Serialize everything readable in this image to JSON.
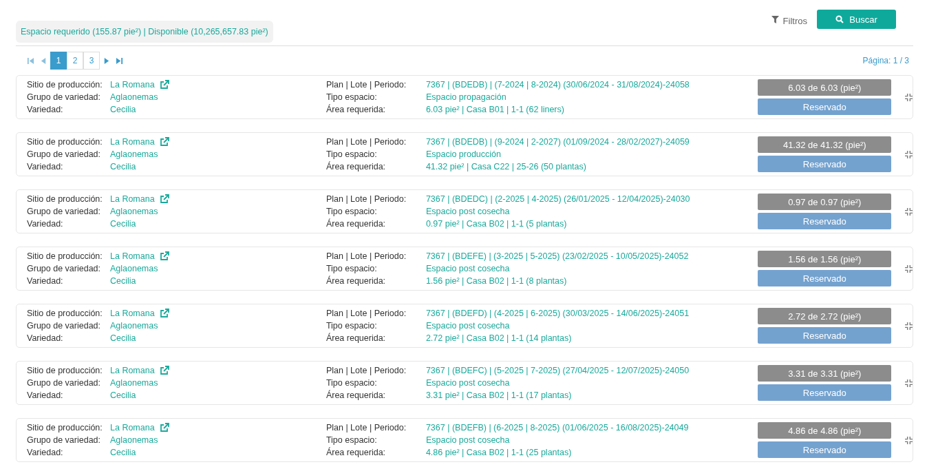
{
  "summary": "Espacio requerido (155.87 pie²) | Disponible (10,265,657.83 pie²)",
  "filters_label": "Filtros",
  "search_button": "Buscar",
  "pagination": {
    "pages": [
      {
        "label": "1",
        "selected": true
      },
      {
        "label": "2",
        "selected": false
      },
      {
        "label": "3",
        "selected": false
      }
    ],
    "page_info": "Página: 1 / 3"
  },
  "cards": [
    {
      "site_label": "Sitio de producción:",
      "site": "La Romana",
      "group_label": "Grupo de variedad:",
      "group": "Aglaonemas",
      "variety_label": "Variedad:",
      "variety": "Cecilia",
      "plan_label": "Plan | Lote | Periodo:",
      "plan": "7367 | (BDEDB) | (7-2024 | 8-2024) (30/06/2024 - 31/08/2024)-24058",
      "type_label": "Tipo espacio:",
      "type": "Espacio propagación",
      "area_label": "Área requerida:",
      "area": "6.03 pie² | Casa B01 | 1-1 (62 liners)",
      "amount": "6.03 de 6.03 (pie²)",
      "status": "Reservado"
    },
    {
      "site_label": "Sitio de producción:",
      "site": "La Romana",
      "group_label": "Grupo de variedad:",
      "group": "Aglaonemas",
      "variety_label": "Variedad:",
      "variety": "Cecilia",
      "plan_label": "Plan | Lote | Periodo:",
      "plan": "7367 | (BDEDB) | (9-2024 | 2-2027) (01/09/2024 - 28/02/2027)-24059",
      "type_label": "Tipo espacio:",
      "type": "Espacio producción",
      "area_label": "Área requerida:",
      "area": "41.32 pie² | Casa C22 | 25-26 (50 plantas)",
      "amount": "41.32 de 41.32 (pie²)",
      "status": "Reservado"
    },
    {
      "site_label": "Sitio de producción:",
      "site": "La Romana",
      "group_label": "Grupo de variedad:",
      "group": "Aglaonemas",
      "variety_label": "Variedad:",
      "variety": "Cecilia",
      "plan_label": "Plan | Lote | Periodo:",
      "plan": "7367 | (BDEDC) | (2-2025 | 4-2025) (26/01/2025 - 12/04/2025)-24030",
      "type_label": "Tipo espacio:",
      "type": "Espacio post cosecha",
      "area_label": "Área requerida:",
      "area": "0.97 pie² | Casa B02 | 1-1 (5 plantas)",
      "amount": "0.97 de 0.97 (pie²)",
      "status": "Reservado"
    },
    {
      "site_label": "Sitio de producción:",
      "site": "La Romana",
      "group_label": "Grupo de variedad:",
      "group": "Aglaonemas",
      "variety_label": "Variedad:",
      "variety": "Cecilia",
      "plan_label": "Plan | Lote | Periodo:",
      "plan": "7367 | (BDEFE) | (3-2025 | 5-2025) (23/02/2025 - 10/05/2025)-24052",
      "type_label": "Tipo espacio:",
      "type": "Espacio post cosecha",
      "area_label": "Área requerida:",
      "area": "1.56 pie² | Casa B02 | 1-1 (8 plantas)",
      "amount": "1.56 de 1.56 (pie²)",
      "status": "Reservado"
    },
    {
      "site_label": "Sitio de producción:",
      "site": "La Romana",
      "group_label": "Grupo de variedad:",
      "group": "Aglaonemas",
      "variety_label": "Variedad:",
      "variety": "Cecilia",
      "plan_label": "Plan | Lote | Periodo:",
      "plan": "7367 | (BDEFD) | (4-2025 | 6-2025) (30/03/2025 - 14/06/2025)-24051",
      "type_label": "Tipo espacio:",
      "type": "Espacio post cosecha",
      "area_label": "Área requerida:",
      "area": "2.72 pie² | Casa B02 | 1-1 (14 plantas)",
      "amount": "2.72 de 2.72 (pie²)",
      "status": "Reservado"
    },
    {
      "site_label": "Sitio de producción:",
      "site": "La Romana",
      "group_label": "Grupo de variedad:",
      "group": "Aglaonemas",
      "variety_label": "Variedad:",
      "variety": "Cecilia",
      "plan_label": "Plan | Lote | Periodo:",
      "plan": "7367 | (BDEFC) | (5-2025 | 7-2025) (27/04/2025 - 12/07/2025)-24050",
      "type_label": "Tipo espacio:",
      "type": "Espacio post cosecha",
      "area_label": "Área requerida:",
      "area": "3.31 pie² | Casa B02 | 1-1 (17 plantas)",
      "amount": "3.31 de 3.31 (pie²)",
      "status": "Reservado"
    },
    {
      "site_label": "Sitio de producción:",
      "site": "La Romana",
      "group_label": "Grupo de variedad:",
      "group": "Aglaonemas",
      "variety_label": "Variedad:",
      "variety": "Cecilia",
      "plan_label": "Plan | Lote | Periodo:",
      "plan": "7367 | (BDEFB) | (6-2025 | 8-2025) (01/06/2025 - 16/08/2025)-24049",
      "type_label": "Tipo espacio:",
      "type": "Espacio post cosecha",
      "area_label": "Área requerida:",
      "area": "4.86 pie² | Casa B02 | 1-1 (25 plantas)",
      "amount": "4.86 de 4.86 (pie²)",
      "status": "Reservado"
    }
  ]
}
